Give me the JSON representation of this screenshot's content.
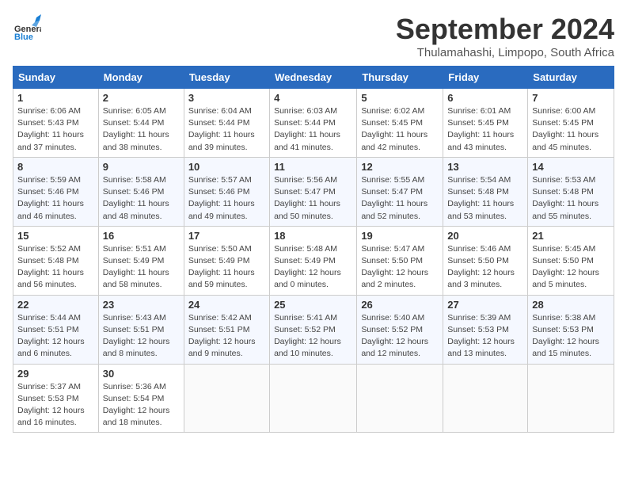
{
  "header": {
    "logo": {
      "general": "General",
      "blue": "Blue"
    },
    "title": "September 2024",
    "location": "Thulamahashi, Limpopo, South Africa"
  },
  "weekdays": [
    "Sunday",
    "Monday",
    "Tuesday",
    "Wednesday",
    "Thursday",
    "Friday",
    "Saturday"
  ],
  "weeks": [
    [
      {
        "day": "1",
        "info": "Sunrise: 6:06 AM\nSunset: 5:43 PM\nDaylight: 11 hours\nand 37 minutes."
      },
      {
        "day": "2",
        "info": "Sunrise: 6:05 AM\nSunset: 5:44 PM\nDaylight: 11 hours\nand 38 minutes."
      },
      {
        "day": "3",
        "info": "Sunrise: 6:04 AM\nSunset: 5:44 PM\nDaylight: 11 hours\nand 39 minutes."
      },
      {
        "day": "4",
        "info": "Sunrise: 6:03 AM\nSunset: 5:44 PM\nDaylight: 11 hours\nand 41 minutes."
      },
      {
        "day": "5",
        "info": "Sunrise: 6:02 AM\nSunset: 5:45 PM\nDaylight: 11 hours\nand 42 minutes."
      },
      {
        "day": "6",
        "info": "Sunrise: 6:01 AM\nSunset: 5:45 PM\nDaylight: 11 hours\nand 43 minutes."
      },
      {
        "day": "7",
        "info": "Sunrise: 6:00 AM\nSunset: 5:45 PM\nDaylight: 11 hours\nand 45 minutes."
      }
    ],
    [
      {
        "day": "8",
        "info": "Sunrise: 5:59 AM\nSunset: 5:46 PM\nDaylight: 11 hours\nand 46 minutes."
      },
      {
        "day": "9",
        "info": "Sunrise: 5:58 AM\nSunset: 5:46 PM\nDaylight: 11 hours\nand 48 minutes."
      },
      {
        "day": "10",
        "info": "Sunrise: 5:57 AM\nSunset: 5:46 PM\nDaylight: 11 hours\nand 49 minutes."
      },
      {
        "day": "11",
        "info": "Sunrise: 5:56 AM\nSunset: 5:47 PM\nDaylight: 11 hours\nand 50 minutes."
      },
      {
        "day": "12",
        "info": "Sunrise: 5:55 AM\nSunset: 5:47 PM\nDaylight: 11 hours\nand 52 minutes."
      },
      {
        "day": "13",
        "info": "Sunrise: 5:54 AM\nSunset: 5:48 PM\nDaylight: 11 hours\nand 53 minutes."
      },
      {
        "day": "14",
        "info": "Sunrise: 5:53 AM\nSunset: 5:48 PM\nDaylight: 11 hours\nand 55 minutes."
      }
    ],
    [
      {
        "day": "15",
        "info": "Sunrise: 5:52 AM\nSunset: 5:48 PM\nDaylight: 11 hours\nand 56 minutes."
      },
      {
        "day": "16",
        "info": "Sunrise: 5:51 AM\nSunset: 5:49 PM\nDaylight: 11 hours\nand 58 minutes."
      },
      {
        "day": "17",
        "info": "Sunrise: 5:50 AM\nSunset: 5:49 PM\nDaylight: 11 hours\nand 59 minutes."
      },
      {
        "day": "18",
        "info": "Sunrise: 5:48 AM\nSunset: 5:49 PM\nDaylight: 12 hours\nand 0 minutes."
      },
      {
        "day": "19",
        "info": "Sunrise: 5:47 AM\nSunset: 5:50 PM\nDaylight: 12 hours\nand 2 minutes."
      },
      {
        "day": "20",
        "info": "Sunrise: 5:46 AM\nSunset: 5:50 PM\nDaylight: 12 hours\nand 3 minutes."
      },
      {
        "day": "21",
        "info": "Sunrise: 5:45 AM\nSunset: 5:50 PM\nDaylight: 12 hours\nand 5 minutes."
      }
    ],
    [
      {
        "day": "22",
        "info": "Sunrise: 5:44 AM\nSunset: 5:51 PM\nDaylight: 12 hours\nand 6 minutes."
      },
      {
        "day": "23",
        "info": "Sunrise: 5:43 AM\nSunset: 5:51 PM\nDaylight: 12 hours\nand 8 minutes."
      },
      {
        "day": "24",
        "info": "Sunrise: 5:42 AM\nSunset: 5:51 PM\nDaylight: 12 hours\nand 9 minutes."
      },
      {
        "day": "25",
        "info": "Sunrise: 5:41 AM\nSunset: 5:52 PM\nDaylight: 12 hours\nand 10 minutes."
      },
      {
        "day": "26",
        "info": "Sunrise: 5:40 AM\nSunset: 5:52 PM\nDaylight: 12 hours\nand 12 minutes."
      },
      {
        "day": "27",
        "info": "Sunrise: 5:39 AM\nSunset: 5:53 PM\nDaylight: 12 hours\nand 13 minutes."
      },
      {
        "day": "28",
        "info": "Sunrise: 5:38 AM\nSunset: 5:53 PM\nDaylight: 12 hours\nand 15 minutes."
      }
    ],
    [
      {
        "day": "29",
        "info": "Sunrise: 5:37 AM\nSunset: 5:53 PM\nDaylight: 12 hours\nand 16 minutes."
      },
      {
        "day": "30",
        "info": "Sunrise: 5:36 AM\nSunset: 5:54 PM\nDaylight: 12 hours\nand 18 minutes."
      },
      {
        "day": "",
        "info": ""
      },
      {
        "day": "",
        "info": ""
      },
      {
        "day": "",
        "info": ""
      },
      {
        "day": "",
        "info": ""
      },
      {
        "day": "",
        "info": ""
      }
    ]
  ]
}
